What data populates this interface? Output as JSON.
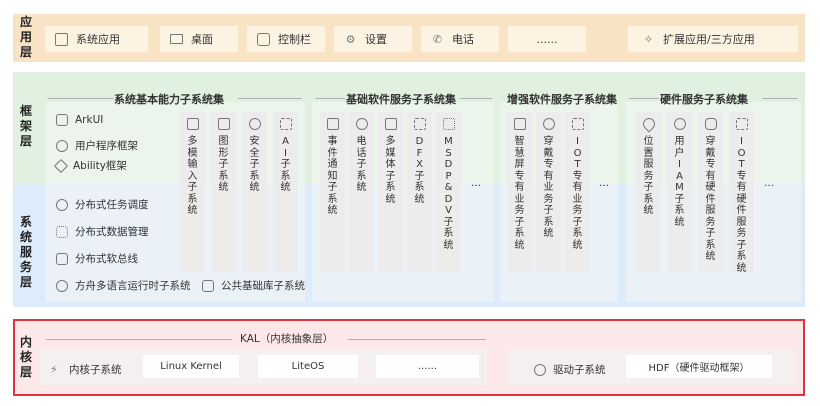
{
  "layers": {
    "app": "应用层",
    "framework": "框架层",
    "services": "系统服务层",
    "kernel": "内核层"
  },
  "app_layer": {
    "tiles": [
      {
        "label": "系统应用",
        "icon": "window-icon"
      },
      {
        "label": "桌面",
        "icon": "monitor-icon"
      },
      {
        "label": "控制栏",
        "icon": "control-icon"
      },
      {
        "label": "设置",
        "icon": "gear-icon"
      },
      {
        "label": "电话",
        "icon": "phone-icon"
      },
      {
        "label": "......",
        "icon": ""
      },
      {
        "label": "扩展应用/三方应用",
        "icon": "puzzle-icon"
      }
    ]
  },
  "basic_capability": {
    "title": "系统基本能力子系统集",
    "framework_items": [
      "ArkUI",
      "用户程序框架",
      "Ability框架"
    ],
    "service_items": [
      "分布式任务调度",
      "分布式数据管理",
      "分布式软总线",
      "方舟多语言运行时子系统",
      "公共基础库子系统"
    ],
    "columns": [
      "多模输入子系统",
      "图形子系统",
      "安全子系统",
      "AI子系统"
    ]
  },
  "basic_software": {
    "title": "基础软件服务子系统集",
    "columns": [
      "事件通知子系统",
      "电话子系统",
      "多媒体子系统",
      "DFX子系统",
      "MSDP&DV子系统",
      "…"
    ]
  },
  "enhanced_software": {
    "title": "增强软件服务子系统集",
    "columns": [
      "智慧屏专有业务子系统",
      "穿戴专有业务子系统",
      "IOT专有业务子系统",
      "…"
    ]
  },
  "hardware_services": {
    "title": "硬件服务子系统集",
    "columns": [
      "位置服务子系统",
      "用户IAM子系统",
      "穿戴专有硬件服务子系统",
      "IOT专有硬件服务子系统",
      "…"
    ]
  },
  "kernel_layer": {
    "kal": "KAL（内核抽象层）",
    "kernel_subsystem": "内核子系统",
    "kernels": [
      "Linux Kernel",
      "LiteOS",
      "......"
    ],
    "driver_subsystem": "驱动子系统",
    "hdf": "HDF（硬件驱动框架）"
  },
  "colors": {
    "app_band": "#f8e3c4",
    "framework_band": "#e0f1e0",
    "services_band": "#dcecfb",
    "kernel_band": "#fce8e8",
    "kernel_border": "#e0343c"
  }
}
